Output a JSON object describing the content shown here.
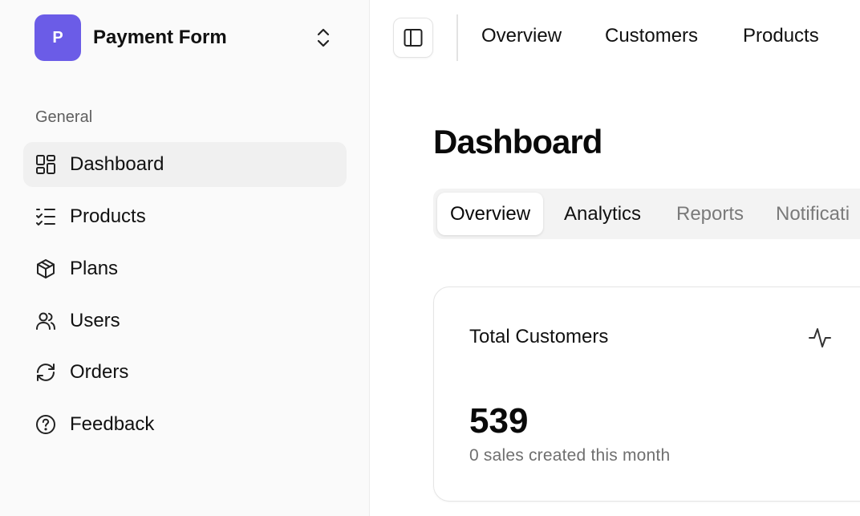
{
  "team": {
    "initial": "P",
    "name": "Payment Form"
  },
  "sidebar": {
    "group_label": "General",
    "items": [
      {
        "label": "Dashboard",
        "icon": "dashboard-grid-icon"
      },
      {
        "label": "Products",
        "icon": "list-checks-icon"
      },
      {
        "label": "Plans",
        "icon": "package-icon"
      },
      {
        "label": "Users",
        "icon": "users-icon"
      },
      {
        "label": "Orders",
        "icon": "refresh-icon"
      },
      {
        "label": "Feedback",
        "icon": "help-circle-icon"
      }
    ]
  },
  "topnav": {
    "items": [
      "Overview",
      "Customers",
      "Products"
    ]
  },
  "page": {
    "title": "Dashboard"
  },
  "tabs": [
    "Overview",
    "Analytics",
    "Reports",
    "Notificati"
  ],
  "card": {
    "title": "Total Customers",
    "value": "539",
    "subtitle": "0 sales created this month",
    "icon": "activity-icon"
  },
  "colors": {
    "brand": "#6b5ce7",
    "sidebar_bg": "#fafafa",
    "active_item_bg": "#f0f0f0",
    "muted_text": "#7a7a7a"
  }
}
